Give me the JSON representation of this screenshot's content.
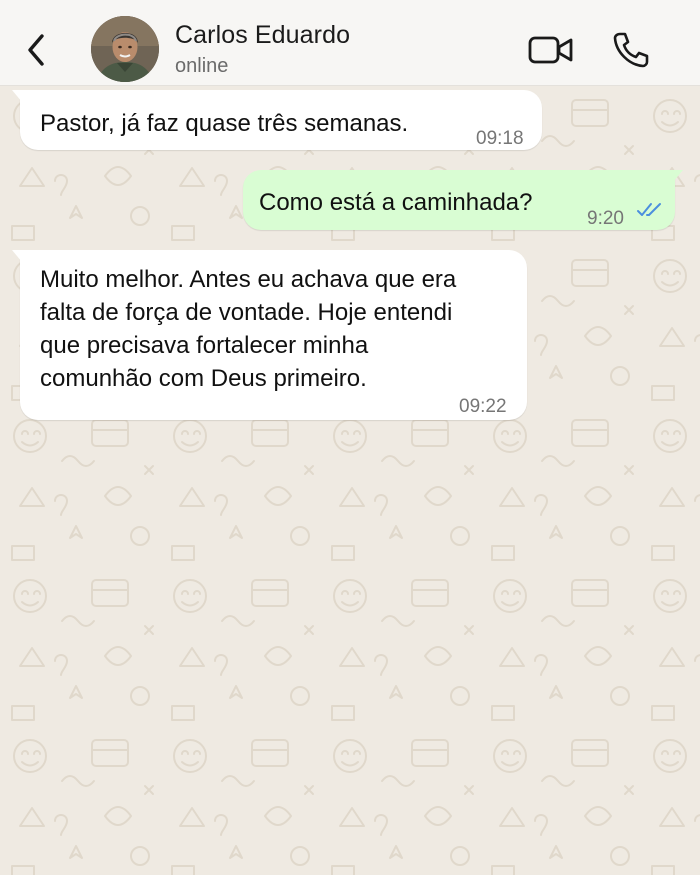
{
  "header": {
    "contact_name": "Carlos Eduardo",
    "status": "online"
  },
  "messages": [
    {
      "direction": "incoming",
      "text": "Pastor, já faz quase três semanas.",
      "time": "09:18"
    },
    {
      "direction": "outgoing",
      "text": "Como está a caminhada?",
      "time": "9:20",
      "read_status": "read"
    },
    {
      "direction": "incoming",
      "lines": [
        "Muito melhor. Antes eu achava que era",
        "falta de força de vontade. Hoje entendi",
        "que precisava fortalecer minha",
        "comunhão com Deus primeiro."
      ],
      "time": "09:22"
    }
  ],
  "icons": {
    "back": "chevron-left-icon",
    "video": "video-camera-icon",
    "call": "phone-icon",
    "read_ticks": "double-check-icon"
  },
  "colors": {
    "chat_background": "#efeae2",
    "header_background": "#f7f6f4",
    "incoming_bubble": "#ffffff",
    "outgoing_bubble": "#d9fdd3",
    "read_tick": "#4b8fde"
  }
}
